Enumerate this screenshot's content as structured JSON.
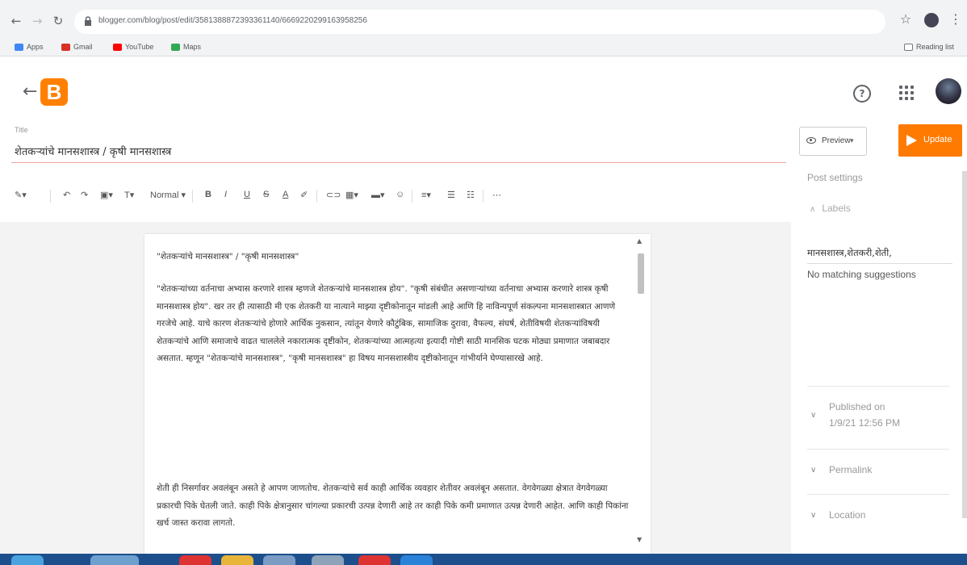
{
  "browser": {
    "url": "blogger.com/blog/post/edit/358138887239336114​0/666922029916395825​6",
    "bookmarks": [
      {
        "label": "Apps",
        "color": "#4285f4"
      },
      {
        "label": "Gmail",
        "color": "#d93025"
      },
      {
        "label": "YouTube",
        "color": "#ff0000"
      },
      {
        "label": "Maps",
        "color": "#34a853"
      }
    ],
    "reading_list": "Reading list"
  },
  "app": {
    "logo_letter": "B",
    "brand_color": "#ff8000"
  },
  "post": {
    "title_label": "Title",
    "title": "शेतकऱ्यांचे मानसशास्त्र / कृषी मानसशास्त्र"
  },
  "toolbar": {
    "format_style": "Normal"
  },
  "editor": {
    "paragraphs": [
      "\"शेतकऱ्यांचे मानसशास्त्र\" / \"कृषी मानसशास्त्र\"",
      "\"शेतकऱ्यांच्या वर्तनाचा अभ्यास करणारे शास्त्र म्हणजे शेतकऱ्यांचे मानसशास्त्र होय\". \"कृषी संबंधीत असणाऱ्यांच्या वर्तनाचा अभ्यास करणारे शास्त्र कृषी मानसशास्त्र होय\". खर तर ही त्यासाठी मी एक शेतकरी या नात्याने माझ्या दृष्टीकोनातून मांडली आहे आणि हि नाविन्यपूर्ण संकल्पना मानसशास्त्रात आणणे गरजेचे आहे. याचे कारण शेतकऱ्यांचे होणारे आर्थिक नुकसान, त्यांतून येणारे कौटुंबिक, सामाजिक दुरावा, वैफल्य, संघर्ष, शेतीविषयी शेतकऱ्यांविषयी शेतकऱ्यांचे आणि समाजाचे वाढत चाललेले नकारात्मक दृष्टीकोन, शेतकऱ्यांच्या आत्महत्या इत्यादी गोष्टी साठी मानसिक घटक मोठ्या प्रमाणात जबाबदार असतात. म्हणून \"शेतकऱ्यांचे मानसशास्त्र\", \"कृषी मानसशास्त्र\" हा विषय मानसशास्त्रीय दृष्टीकोनातून गांभीर्याने घेण्यासारखे आहे.",
      "शेती ही निसर्गावर अवलंबून असते हे आपण जाणतोच. शेतकऱ्यांचे सर्व काही आर्थिक व्यवहार शेतीवर अवलंबून असतात. वेगवेगळ्या क्षेत्रात वेगवेगळ्या प्रकारची पिके घेतली जाते. काही पिके क्षेत्रानुसार चांगल्या प्रकारची उत्पन्न देणारी आहे तर काही पिके कमी प्रमाणात उत्पन्न देणारी आहेत. आणि काही पिकांना खर्च जास्त करावा लागतो."
    ]
  },
  "sidebar": {
    "preview_label": "Preview",
    "update_label": "Update",
    "post_settings": "Post settings",
    "labels_title": "Labels",
    "labels_value": "मानसशास्त्र,शेतकरी,शेती,",
    "no_match": "No matching suggestions",
    "published_on": "Published on",
    "published_date": "1/9/21 12:56 PM",
    "permalink": "Permalink",
    "location": "Location",
    "update_color": "#ff7a00"
  }
}
